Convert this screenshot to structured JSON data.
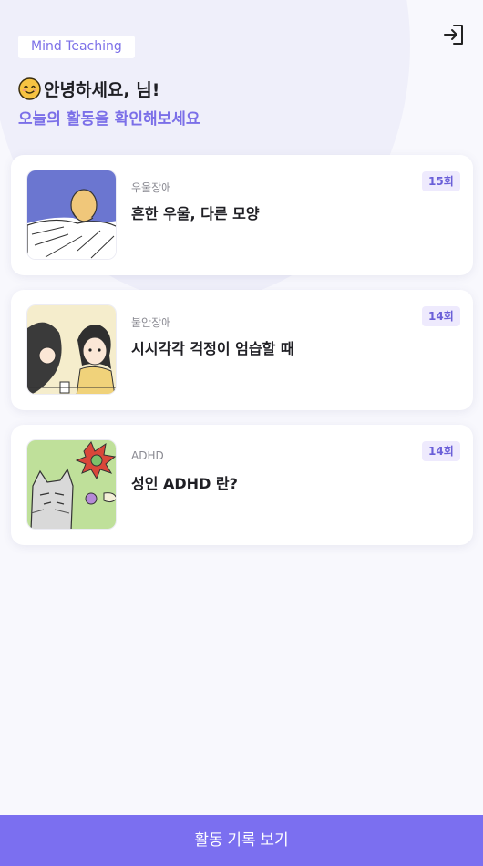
{
  "header": {
    "brand": "Mind Teaching",
    "greeting": "안녕하세요, 님!",
    "subtitle": "오늘의 활동을 확인해보세요",
    "logout_icon": "logout-icon",
    "greeting_emoji": "smiling-face-icon"
  },
  "cards": [
    {
      "category": "우울장애",
      "title": "흔한 우울, 다른 모양",
      "count": "15회",
      "thumbnail": "depression-illustration"
    },
    {
      "category": "불안장애",
      "title": "시시각각 걱정이 엄습할 때",
      "count": "14회",
      "thumbnail": "anxiety-illustration"
    },
    {
      "category": "ADHD",
      "title": "성인 ADHD 란?",
      "count": "14회",
      "thumbnail": "adhd-illustration"
    }
  ],
  "bottom_button": {
    "label": "활동 기록 보기"
  },
  "colors": {
    "accent": "#7b6ff0",
    "brand_text": "#7b6fe8",
    "background": "#f8f8fd"
  }
}
